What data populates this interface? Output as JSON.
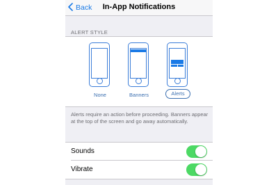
{
  "nav": {
    "back_label": "Back",
    "title": "In-App Notifications"
  },
  "alert_style": {
    "header": "ALERT STYLE",
    "options": [
      {
        "label": "None",
        "selected": false
      },
      {
        "label": "Banners",
        "selected": false
      },
      {
        "label": "Alerts",
        "selected": true
      }
    ],
    "footnote": "Alerts require an action before proceeding. Banners appear at the top of the screen and go away automatically."
  },
  "settings": [
    {
      "label": "Sounds",
      "on": true
    },
    {
      "label": "Vibrate",
      "on": true
    }
  ],
  "colors": {
    "accent": "#1a7ae6",
    "toggle_on": "#4cd964"
  }
}
